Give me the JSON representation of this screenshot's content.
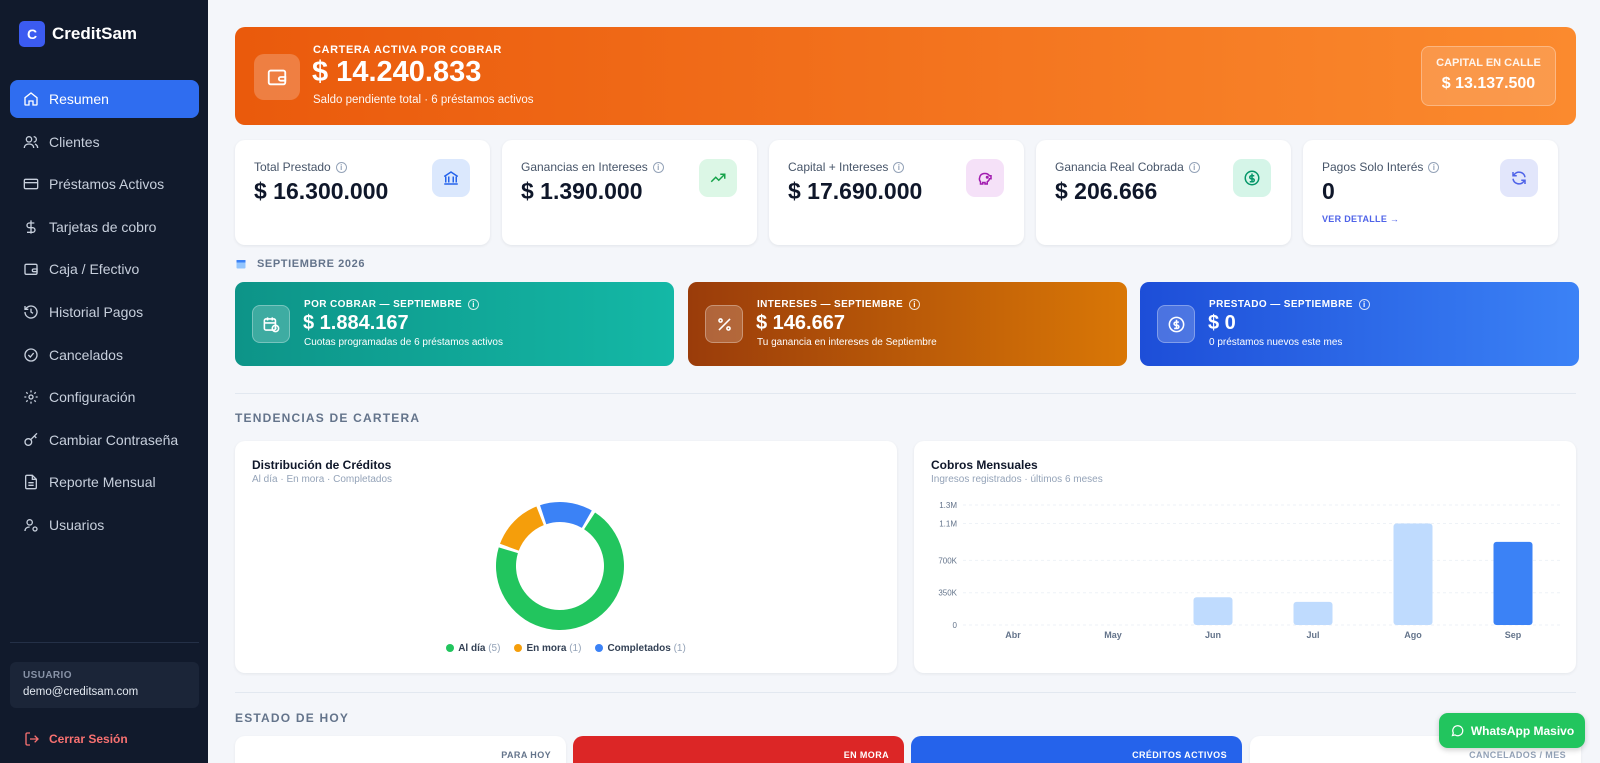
{
  "brand": {
    "logo_letter": "C",
    "name": "CreditSam"
  },
  "nav": [
    {
      "label": "Resumen",
      "icon": "home-icon",
      "active": true
    },
    {
      "label": "Clientes",
      "icon": "users-icon"
    },
    {
      "label": "Préstamos Activos",
      "icon": "credit-card-icon"
    },
    {
      "label": "Tarjetas de cobro",
      "icon": "dollar-icon"
    },
    {
      "label": "Caja / Efectivo",
      "icon": "wallet-icon"
    },
    {
      "label": "Historial Pagos",
      "icon": "history-icon"
    },
    {
      "label": "Cancelados",
      "icon": "check-circle-icon"
    },
    {
      "label": "Configuración",
      "icon": "gear-icon"
    },
    {
      "label": "Cambiar Contraseña",
      "icon": "key-icon"
    },
    {
      "label": "Reporte Mensual",
      "icon": "document-icon"
    },
    {
      "label": "Usuarios",
      "icon": "user-settings-icon"
    }
  ],
  "user": {
    "label": "USUARIO",
    "email": "demo@creditsam.com"
  },
  "logout_label": "Cerrar Sesión",
  "hero": {
    "label": "CARTERA ACTIVA POR COBRAR",
    "value": "$ 14.240.833",
    "sub": "Saldo pendiente total · 6 préstamos activos",
    "capital_label": "CAPITAL EN CALLE",
    "capital_value": "$ 13.137.500"
  },
  "stats": [
    {
      "label": "Total Prestado",
      "value": "$ 16.300.000",
      "icon": "bank-icon",
      "color": "#2563eb",
      "bg": "#dbe8fd"
    },
    {
      "label": "Ganancias en Intereses",
      "value": "$ 1.390.000",
      "icon": "trending-up-icon",
      "color": "#16a34a",
      "bg": "#dcf7e6"
    },
    {
      "label": "Capital + Intereses",
      "value": "$ 17.690.000",
      "icon": "piggy-bank-icon",
      "color": "#a21caf",
      "bg": "#f5e1f8"
    },
    {
      "label": "Ganancia Real Cobrada",
      "value": "$ 206.666",
      "icon": "dollar-circle-icon",
      "color": "#059669",
      "bg": "#d5f5e8"
    },
    {
      "label": "Pagos Solo Interés",
      "value": "0",
      "icon": "refresh-icon",
      "color": "#4f63e8",
      "bg": "#e2e6fb",
      "link": "VER DETALLE →"
    }
  ],
  "month_label": "SEPTIEMBRE 2026",
  "month_cards": [
    {
      "label": "POR COBRAR — SEPTIEMBRE",
      "value": "$ 1.884.167",
      "sub": "Cuotas programadas de 6 préstamos activos",
      "icon": "calendar-clock-icon"
    },
    {
      "label": "INTERESES — SEPTIEMBRE",
      "value": "$ 146.667",
      "sub": "Tu ganancia en intereses de Septiembre",
      "icon": "percent-icon"
    },
    {
      "label": "PRESTADO — SEPTIEMBRE",
      "value": "$ 0",
      "sub": "0 préstamos nuevos este mes",
      "icon": "dollar-circle-icon"
    }
  ],
  "trends_title": "TENDENCIAS DE CARTERA",
  "today_title": "ESTADO DE HOY",
  "donut_panel": {
    "title": "Distribución de Créditos",
    "sub": "Al día · En mora · Completados"
  },
  "bar_panel": {
    "title": "Cobros Mensuales",
    "sub": "Ingresos registrados · últimos 6 meses"
  },
  "chart_data": [
    {
      "type": "pie",
      "title": "Distribución de Créditos",
      "labels": [
        "Al día",
        "En mora",
        "Completados"
      ],
      "values": [
        5,
        1,
        1
      ],
      "colors": [
        "#22c55e",
        "#f59e0b",
        "#3b82f6"
      ]
    },
    {
      "type": "bar",
      "title": "Cobros Mensuales",
      "categories": [
        "Abr",
        "May",
        "Jun",
        "Jul",
        "Ago",
        "Sep"
      ],
      "values": [
        0,
        0,
        300000,
        250000,
        1100000,
        900000
      ],
      "ylim": [
        0,
        1300000
      ],
      "yticks": [
        0,
        350000,
        700000,
        1100000,
        1300000
      ],
      "ytick_labels": [
        "0",
        "350K",
        "700K",
        "1.1M",
        "1.3M"
      ],
      "highlight_last": true,
      "colors": {
        "bar": "#bfdbfe",
        "current": "#3b82f6"
      }
    }
  ],
  "bottom_cards": [
    "PARA HOY",
    "EN MORA",
    "CRÉDITOS ACTIVOS",
    "CANCELADOS / MES"
  ],
  "whatsapp_label": "WhatsApp Masivo"
}
